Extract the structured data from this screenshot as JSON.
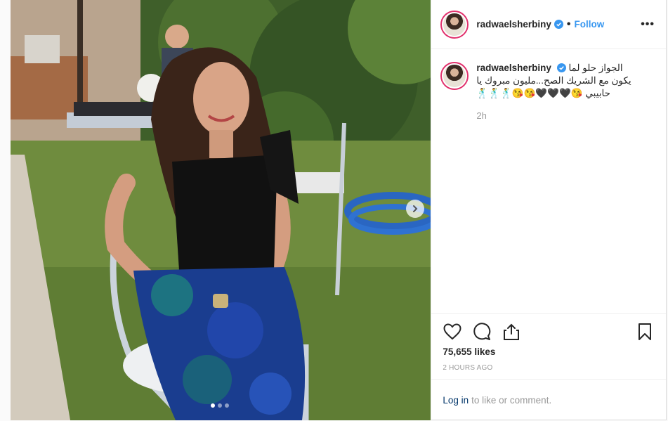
{
  "post": {
    "username": "radwaelsherbiny",
    "follow_label": "Follow",
    "separator": "•",
    "more_label": "•••",
    "caption": "الجواز حلو لما يكون مع الشريك الصح...مليون مبروك يا حابيبي 😘🖤🖤🖤😘😘🕺🕺🕺",
    "time_since": "2h",
    "likes": "75,655 likes",
    "posted_ago": "2 HOURS AGO",
    "login_link": "Log in",
    "login_suffix": "to like or comment."
  },
  "carousel": {
    "slide_count": 3,
    "active_index": 0
  },
  "icons": {
    "verified": "verified-badge-icon",
    "like": "heart-icon",
    "comment": "comment-bubble-icon",
    "share": "share-icon",
    "save": "bookmark-icon",
    "next": "chevron-right-icon"
  },
  "colors": {
    "accent": "#3897f0",
    "verified": "#3897f0",
    "link_dark": "#003569",
    "muted": "#999999",
    "text": "#262626"
  }
}
